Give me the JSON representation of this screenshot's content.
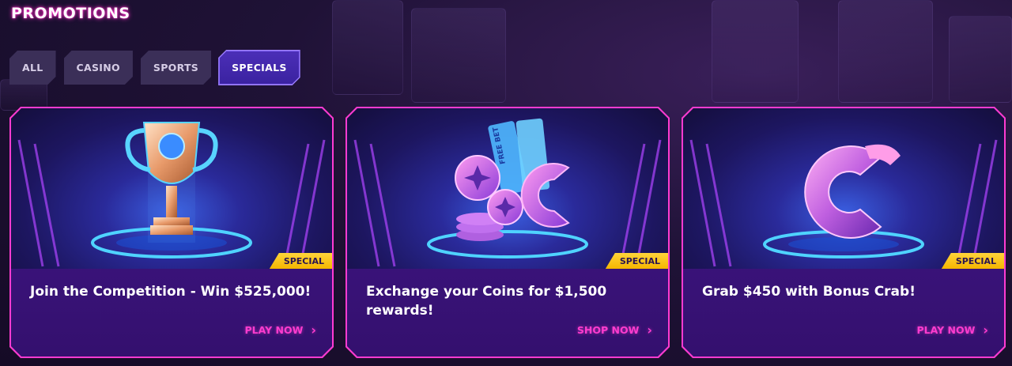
{
  "page": {
    "title": "PROMOTIONS"
  },
  "tabs": [
    {
      "label": "ALL",
      "active": false
    },
    {
      "label": "CASINO",
      "active": false
    },
    {
      "label": "SPORTS",
      "active": false
    },
    {
      "label": "SPECIALS",
      "active": true
    }
  ],
  "promotions": [
    {
      "badge": "SPECIAL",
      "title": "Join the Competition - Win $525,000!",
      "cta": "PLAY NOW",
      "image_icon": "trophy-icon"
    },
    {
      "badge": "SPECIAL",
      "title": "Exchange your Coins for $1,500 rewards!",
      "cta": "SHOP NOW",
      "image_icon": "coins-tickets-icon",
      "ticket_text": "FREE BET"
    },
    {
      "badge": "SPECIAL",
      "title": "Grab $450 with Bonus Crab!",
      "cta": "PLAY NOW",
      "image_icon": "crab-c-logo-icon"
    }
  ],
  "colors": {
    "accent_pink": "#ff3bd1",
    "badge_yellow": "#f5b600",
    "active_tab": "#4c2fb8",
    "tab_bg": "#3b2f58"
  }
}
